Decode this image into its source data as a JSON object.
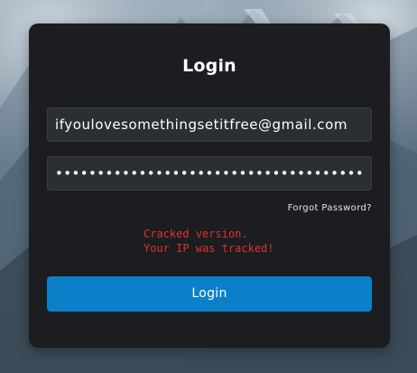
{
  "login": {
    "title": "Login",
    "email_value": "ifyoulovesomethingsetitfree@gmail.com",
    "password_masked": "•••••••••••••••••••••••••••••••••••••",
    "forgot_password": "Forgot Password?",
    "error_line1": "Cracked version.",
    "error_line2": "Your IP was tracked!",
    "button_label": "Login"
  },
  "colors": {
    "card": "#1b1d21",
    "field": "#2b2e33",
    "button": "#0b80c9",
    "error": "#e0322e"
  }
}
